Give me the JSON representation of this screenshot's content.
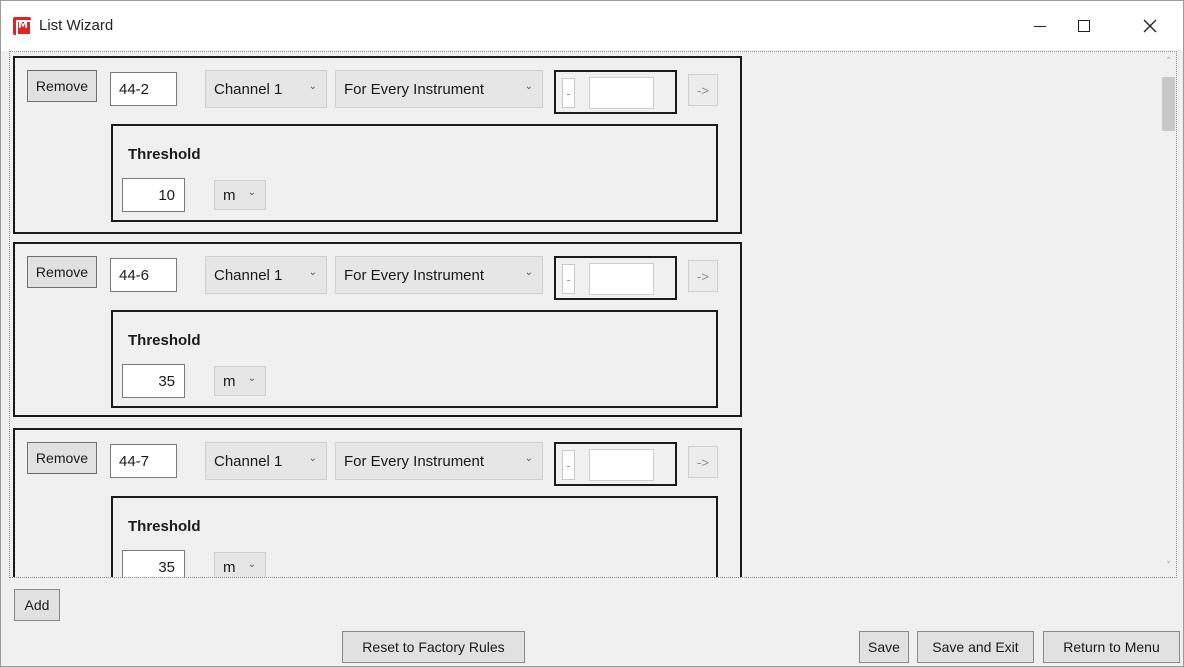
{
  "window": {
    "title": "List Wizard",
    "icon": "app-logo-icon",
    "controls": [
      "minimize-icon",
      "maximize-icon",
      "close-icon"
    ]
  },
  "rules": [
    {
      "remove_label": "Remove",
      "id": "44-2",
      "channel": "Channel 1",
      "scope": "For Every Instrument",
      "range_minus": "-",
      "range_value": "",
      "arrow_label": "->",
      "threshold_label": "Threshold",
      "threshold_value": "10",
      "unit": "m"
    },
    {
      "remove_label": "Remove",
      "id": "44-6",
      "channel": "Channel 1",
      "scope": "For Every Instrument",
      "range_minus": "-",
      "range_value": "",
      "arrow_label": "->",
      "threshold_label": "Threshold",
      "threshold_value": "35",
      "unit": "m"
    },
    {
      "remove_label": "Remove",
      "id": "44-7",
      "channel": "Channel 1",
      "scope": "For Every Instrument",
      "range_minus": "-",
      "range_value": "",
      "arrow_label": "->",
      "threshold_label": "Threshold",
      "threshold_value": "35",
      "unit": "m"
    }
  ],
  "footer": {
    "add_label": "Add",
    "reset_label": "Reset to Factory Rules",
    "save_label": "Save",
    "save_exit_label": "Save and Exit",
    "return_label": "Return to Menu"
  }
}
